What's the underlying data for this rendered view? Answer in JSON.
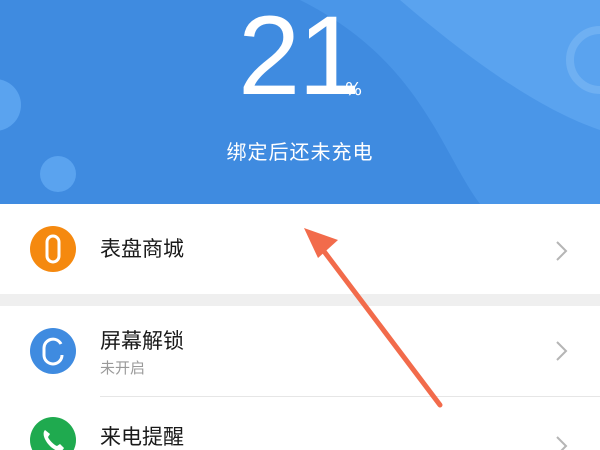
{
  "battery": {
    "percent": "21",
    "unit": "%",
    "status": "绑定后还未充电"
  },
  "menu": {
    "items": [
      {
        "title": "表盘商城",
        "subtitle": "",
        "icon": "watch-band-icon",
        "icon_color": "#f5890f"
      },
      {
        "title": "屏幕解锁",
        "subtitle": "未开启",
        "icon": "unlock-icon",
        "icon_color": "#3f8be0"
      },
      {
        "title": "来电提醒",
        "subtitle": "",
        "icon": "phone-icon",
        "icon_color": "#1faa4f"
      }
    ]
  },
  "colors": {
    "header_bg": "#3f8be0",
    "annotation_arrow": "#f26b4b"
  }
}
